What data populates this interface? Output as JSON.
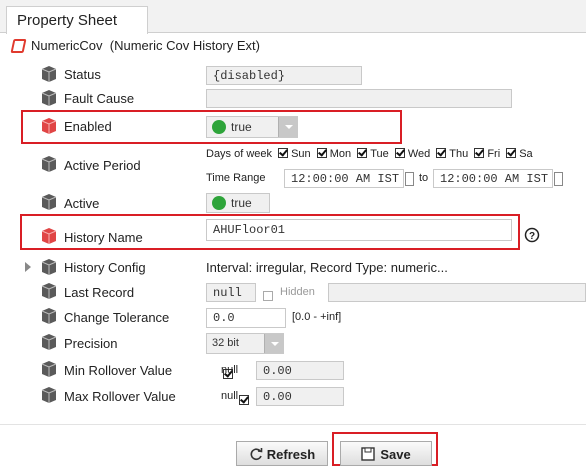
{
  "tab": {
    "label": "Property Sheet"
  },
  "component": {
    "name": "NumericCov",
    "type": "(Numeric Cov History Ext)"
  },
  "rows": {
    "status": {
      "label": "Status",
      "value": "{disabled}"
    },
    "fault_cause": {
      "label": "Fault Cause",
      "value": ""
    },
    "enabled": {
      "label": "Enabled",
      "value": "true"
    },
    "active_period": {
      "label": "Active Period",
      "days_label": "Days of week",
      "days": [
        "Sun",
        "Mon",
        "Tue",
        "Wed",
        "Thu",
        "Fri",
        "Sa"
      ],
      "time_range_label": "Time Range",
      "start": "12:00:00 AM IST",
      "to_label": "to",
      "end": "12:00:00 AM IST"
    },
    "active": {
      "label": "Active",
      "value": "true"
    },
    "history_name": {
      "label": "History Name",
      "value": "AHUFloor01"
    },
    "history_config": {
      "label": "History Config",
      "value": "Interval: irregular, Record Type: numeric..."
    },
    "last_record": {
      "label": "Last Record",
      "value": "null",
      "hidden_label": "Hidden"
    },
    "change_tolerance": {
      "label": "Change Tolerance",
      "value": "0.0",
      "range": "[0.0 - +inf]"
    },
    "precision": {
      "label": "Precision",
      "value": "32 bit"
    },
    "min_rollover": {
      "label": "Min Rollover Value",
      "null_label": "null",
      "value": "0.00"
    },
    "max_rollover": {
      "label": "Max Rollover Value",
      "null_label": "null",
      "value": "0.00"
    }
  },
  "buttons": {
    "refresh": "Refresh",
    "save": "Save"
  },
  "colors": {
    "highlight": "#d91e25",
    "status_green": "#2ea43a"
  }
}
